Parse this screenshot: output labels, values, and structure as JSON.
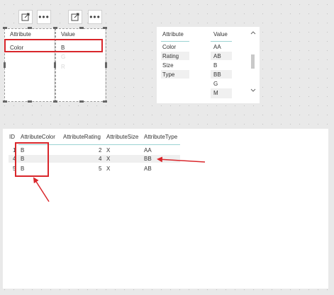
{
  "top_slicer_1": {
    "header": "Attribute",
    "items": [
      "Color"
    ]
  },
  "top_slicer_2": {
    "header": "Value",
    "items": [
      "B",
      "G",
      "R"
    ]
  },
  "toolbar": {
    "focus_icon": "focus-mode-icon",
    "more_icon": "more-options-icon",
    "more_glyph": "•••"
  },
  "matrix": {
    "col1_header": "Attribute",
    "col2_header": "Value",
    "attributes": [
      "Color",
      "Rating",
      "Size",
      "Type"
    ],
    "values": [
      "AA",
      "AB",
      "B",
      "BB",
      "G",
      "M"
    ]
  },
  "table": {
    "headers": [
      "ID",
      "AttributeColor",
      "AttributeRating",
      "AttributeSize",
      "AttributeType"
    ],
    "rows": [
      {
        "id": "1",
        "color": "B",
        "rating": "2",
        "size": "X",
        "type": "AA"
      },
      {
        "id": "4",
        "color": "B",
        "rating": "4",
        "size": "X",
        "type": "BB"
      },
      {
        "id": "5",
        "color": "B",
        "rating": "5",
        "size": "X",
        "type": "AB"
      }
    ]
  },
  "colors": {
    "highlight_red": "#d9262b",
    "accent_teal": "#9bd3d3"
  }
}
